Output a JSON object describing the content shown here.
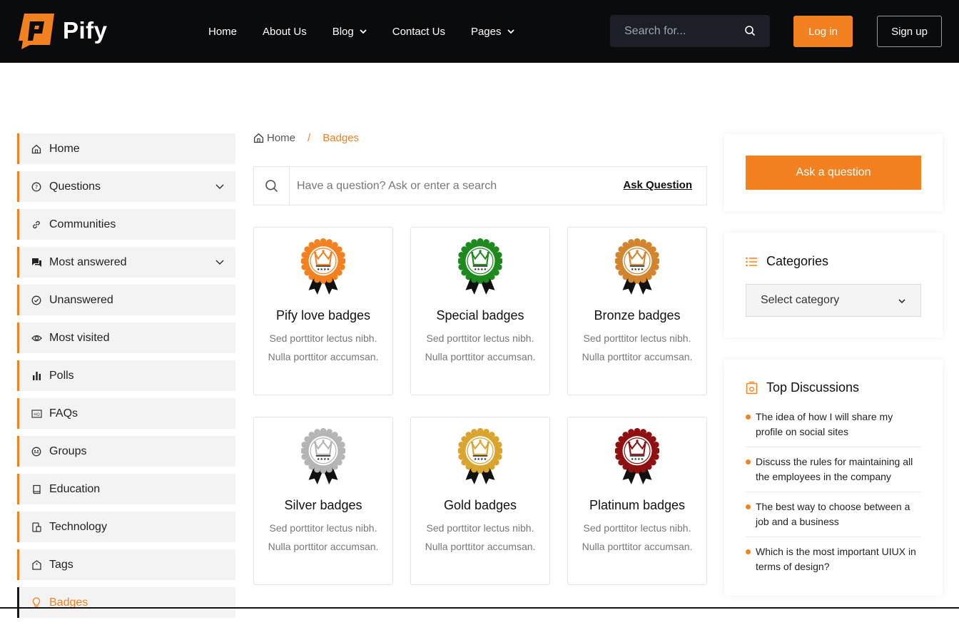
{
  "brand": {
    "name": "Pify",
    "accent": "#f48120",
    "header_bg": "#0a0b0d"
  },
  "nav": {
    "items": [
      {
        "label": "Home",
        "dropdown": false
      },
      {
        "label": "About Us",
        "dropdown": false
      },
      {
        "label": "Blog",
        "dropdown": true
      },
      {
        "label": "Contact Us",
        "dropdown": false
      },
      {
        "label": "Pages",
        "dropdown": true
      }
    ],
    "search_placeholder": "Search for...",
    "login": "Log in",
    "signup": "Sign up"
  },
  "sidebar": {
    "items": [
      {
        "label": "Home",
        "icon": "home-icon"
      },
      {
        "label": "Questions",
        "icon": "question-circle-icon",
        "caret": true
      },
      {
        "label": "Communities",
        "icon": "link-icon"
      },
      {
        "label": "Most answered",
        "icon": "chat-icon",
        "caret": true
      },
      {
        "label": "Unanswered",
        "icon": "check-circle-icon"
      },
      {
        "label": "Most visited",
        "icon": "eye-icon"
      },
      {
        "label": "Polls",
        "icon": "bar-chart-icon"
      },
      {
        "label": "FAQs",
        "icon": "faq-icon"
      },
      {
        "label": "Groups",
        "icon": "groups-icon"
      },
      {
        "label": "Education",
        "icon": "book-icon"
      },
      {
        "label": "Technology",
        "icon": "device-icon"
      },
      {
        "label": "Tags",
        "icon": "tag-icon"
      },
      {
        "label": "Badges",
        "icon": "bulb-icon",
        "active": true
      }
    ]
  },
  "breadcrumb": {
    "home": "Home",
    "separator": "/",
    "current": "Badges"
  },
  "question_search": {
    "placeholder": "Have a question? Ask or enter a search",
    "ask_link": "Ask Question"
  },
  "badges": [
    {
      "title": "Pify love badges",
      "desc": "Sed porttitor lectus nibh. Nulla porttitor accumsan.",
      "color": "#f48120"
    },
    {
      "title": "Special badges",
      "desc": "Sed porttitor lectus nibh. Nulla porttitor accumsan.",
      "color": "#1e8a1e"
    },
    {
      "title": "Bronze badges",
      "desc": "Sed porttitor lectus nibh. Nulla porttitor accumsan.",
      "color": "#d2852d"
    },
    {
      "title": "Silver badges",
      "desc": "Sed porttitor lectus nibh. Nulla porttitor accumsan.",
      "color": "#b5b5b5"
    },
    {
      "title": "Gold badges",
      "desc": "Sed porttitor lectus nibh. Nulla porttitor accumsan.",
      "color": "#d9a52e"
    },
    {
      "title": "Platinum badges",
      "desc": "Sed porttitor lectus nibh. Nulla porttitor accumsan.",
      "color": "#8f1010"
    }
  ],
  "right": {
    "ask_button": "Ask a question",
    "categories": {
      "title": "Categories",
      "select": "Select category"
    },
    "discussions": {
      "title": "Top Discussions",
      "items": [
        "The idea of how I will share my profile on social sites",
        "Discuss the rules for maintaining all the employees in the company",
        "The best way to choose between a job and a business",
        "Which is the most important UIUX in terms of design?"
      ]
    }
  }
}
